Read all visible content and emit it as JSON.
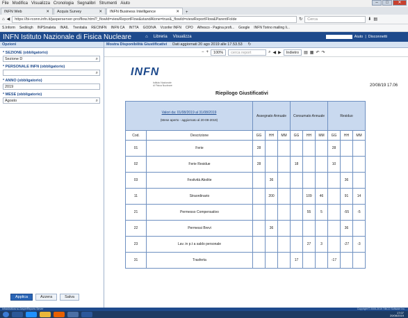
{
  "menubar": [
    "File",
    "Modifica",
    "Visualizza",
    "Cronologia",
    "Segnalibri",
    "Strumenti",
    "Aiuto"
  ],
  "tabs": [
    {
      "label": "INFN Web",
      "active": false
    },
    {
      "label": "Acquis Survey",
      "active": false
    },
    {
      "label": "INFN Business Intelligence",
      "active": true
    }
  ],
  "address": {
    "url": "https://bi-rconn.infn.it/jasperserver-pro/flow.html?_flowId=viewReportFlow&standAlone=true&_flowId=viewReportFlow&ParentFolde",
    "search_placeholder": "Cerca"
  },
  "bookmarks": [
    "S.Inform",
    "Sedi/ogh",
    "INPSmaleta",
    "INAIL",
    "Trenitalia",
    "RECINFN",
    "INFN CA",
    "INTTA",
    "GODIVA",
    "Vconfer INFN",
    "CPO",
    "Alfresco - Pagina profi...",
    "Google",
    "INFN Torino mailing li..."
  ],
  "app": {
    "logo": "INFN Istituto Nazionale di Fisica Nucleare",
    "menu": [
      "Libreria",
      "Visualizza"
    ],
    "user_links": [
      "Aiuto",
      "Disconnetti"
    ]
  },
  "sidebar": {
    "title": "Opzioni",
    "fields": [
      {
        "label": "* SEZIONE (obbligatorio)",
        "value": "Sezione D"
      },
      {
        "label": "* PERSONALE INFN (obbligatorio)",
        "value": ""
      },
      {
        "label": "* ANNO (obbligatorio)",
        "value": "2019"
      },
      {
        "label": "* MESE (obbligatorio)",
        "value": "Agosto"
      }
    ],
    "buttons": {
      "apply": "Applica",
      "cancel": "Azzera",
      "save": "Salva"
    }
  },
  "report_header": {
    "title": "Mostra Disponibilità Giustificativi",
    "updated": "Dati aggiornati 20 ago 2019 alle 17.53.53"
  },
  "toolbar": {
    "zoom": "100%",
    "search_placeholder": "cerca report",
    "back": "Indietro"
  },
  "report": {
    "logo": "INFN",
    "logo_sub": [
      "Istituto Nazionale",
      "di Fisica Nucleare"
    ],
    "date": "20/08/19 17.06",
    "title": "Riepilogo Giustificativi",
    "period": "Valori da: 01/08/2019 al 31/08/2019",
    "period_note": "(Mese aperto - aggiornato al 20-08-2019)",
    "groups": [
      "Assegnato Annuale",
      "Consumato Annuale",
      "Residuo"
    ],
    "columns": [
      "Cod.",
      "Descrizione",
      "GG",
      "HH",
      "MM",
      "GG",
      "HH",
      "MM",
      "GG",
      "HH",
      "MM"
    ],
    "rows": [
      [
        "01",
        "Ferie",
        "28",
        "",
        "",
        "",
        "",
        "",
        "28",
        "",
        ""
      ],
      [
        "02",
        "Ferie Residue",
        "28",
        "",
        "",
        "18",
        "",
        "",
        "10",
        "",
        ""
      ],
      [
        "03",
        "Festività Abolite",
        "",
        "36",
        "",
        "",
        "",
        "",
        "",
        "36",
        ""
      ],
      [
        "11",
        "Straordinario",
        "",
        "200",
        "",
        "",
        "109",
        "46",
        "",
        "91",
        "14"
      ],
      [
        "21",
        "Permesso Compensativo",
        "",
        "",
        "",
        "",
        "55",
        "5",
        "",
        "-55",
        "-5"
      ],
      [
        "22",
        "Permessi Brevi",
        "",
        "36",
        "",
        "",
        "",
        "",
        "",
        "36",
        ""
      ],
      [
        "23",
        "Lav. in p.t a saldo personale",
        "",
        "",
        "",
        "",
        "27",
        "3",
        "",
        "-27",
        "-3"
      ],
      [
        "31",
        "Trasferta",
        "",
        "",
        "",
        "17",
        "",
        "",
        "-17",
        "",
        ""
      ]
    ]
  },
  "status": {
    "left": "Infrastruttura su JasperReports Server",
    "right": "Copyright © 2005-2019 TIBCO Software Inc."
  },
  "clock": {
    "time": "17:07",
    "date": "20/08/2019"
  }
}
